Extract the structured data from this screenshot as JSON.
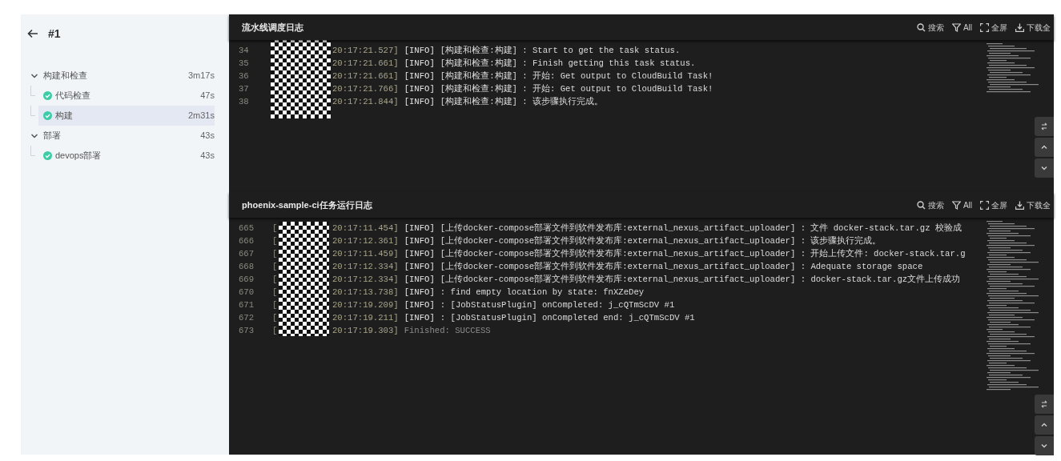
{
  "build": {
    "title": "#1"
  },
  "stages": [
    {
      "name": "构建和检查",
      "duration": "3m17s",
      "expanded": true,
      "children": [
        {
          "name": "代码检查",
          "duration": "47s",
          "passed": true,
          "selected": false
        },
        {
          "name": "构建",
          "duration": "2m31s",
          "passed": true,
          "selected": true
        }
      ]
    },
    {
      "name": "部署",
      "duration": "43s",
      "expanded": true,
      "children": [
        {
          "name": "devops部署",
          "duration": "43s",
          "passed": true,
          "selected": false
        }
      ]
    }
  ],
  "log_panels": [
    {
      "title": "流水线调度日志",
      "actions": [
        {
          "kind": "search",
          "label": "搜索"
        },
        {
          "kind": "filter",
          "label": "All"
        },
        {
          "kind": "fullscreen",
          "label": "全屏"
        },
        {
          "kind": "download",
          "label": "下载全"
        }
      ],
      "lines": [
        {
          "number": "34",
          "time": "20:17:21.527]",
          "level": "[INFO]",
          "message": "[构建和检查:构建] : Start to get the task status.",
          "kind": "info"
        },
        {
          "number": "35",
          "time": "20:17:21.661]",
          "level": "[INFO]",
          "message": "[构建和检查:构建] : Finish getting this task status.",
          "kind": "info"
        },
        {
          "number": "36",
          "time": "20:17:21.661]",
          "level": "[INFO]",
          "message": "[构建和检查:构建] : 开始: Get output to CloudBuild Task!",
          "kind": "info"
        },
        {
          "number": "37",
          "time": "20:17:21.766]",
          "level": "[INFO]",
          "message": "[构建和检查:构建] : 开始: Get output to CloudBuild Task!",
          "kind": "info"
        },
        {
          "number": "38",
          "time": "20:17:21.844]",
          "level": "[INFO]",
          "message": "[构建和检查:构建] : 该步骤执行完成。",
          "kind": "info"
        }
      ]
    },
    {
      "title": "phoenix-sample-ci任务运行日志",
      "actions": [
        {
          "kind": "search",
          "label": "搜索"
        },
        {
          "kind": "filter",
          "label": "All"
        },
        {
          "kind": "fullscreen",
          "label": "全屏"
        },
        {
          "kind": "download",
          "label": "下载全"
        }
      ],
      "lines": [
        {
          "number": "665",
          "prefix": "[",
          "time": "20:17:11.454]",
          "level": "[INFO]",
          "message": "[上传docker-compose部署文件到软件发布库:external_nexus_artifact_uploader] : 文件 docker-stack.tar.gz 校验成",
          "kind": "info"
        },
        {
          "number": "666",
          "prefix": "[",
          "time": "20:17:12.361]",
          "level": "[INFO]",
          "message": "[上传docker-compose部署文件到软件发布库:external_nexus_artifact_uploader] : 该步骤执行完成。",
          "kind": "info"
        },
        {
          "number": "667",
          "prefix": "[",
          "time": "20:17:11.459]",
          "level": "[INFO]",
          "message": "[上传docker-compose部署文件到软件发布库:external_nexus_artifact_uploader] : 开始上传文件: docker-stack.tar.g",
          "kind": "info"
        },
        {
          "number": "668",
          "prefix": "[",
          "time": "20:17:12.334]",
          "level": "[INFO]",
          "message": "[上传docker-compose部署文件到软件发布库:external_nexus_artifact_uploader] : Adequate storage space",
          "kind": "info"
        },
        {
          "number": "669",
          "prefix": "[",
          "time": "20:17:12.334]",
          "level": "[INFO]",
          "message": "[上传docker-compose部署文件到软件发布库:external_nexus_artifact_uploader] : docker-stack.tar.gz文件上传成功",
          "kind": "info"
        },
        {
          "number": "670",
          "prefix": "[",
          "time": "20:17:13.738]",
          "level": "[INFO]",
          "message": " : find empty location by state: fnXZeDey",
          "kind": "info"
        },
        {
          "number": "671",
          "prefix": "[",
          "time": "20:17:19.209]",
          "level": "[INFO]",
          "message": " : [JobStatusPlugin] onCompleted: j_cQTmScDV #1",
          "kind": "info"
        },
        {
          "number": "672",
          "prefix": "[",
          "time": "20:17:19.211]",
          "level": "[INFO]",
          "message": " : [JobStatusPlugin] onCompleted end: j_cQTmScDV #1",
          "kind": "info"
        },
        {
          "number": "673",
          "prefix": "[",
          "time": "20:17:19.303]",
          "message": "Finished: SUCCESS",
          "kind": "summary"
        }
      ]
    }
  ]
}
